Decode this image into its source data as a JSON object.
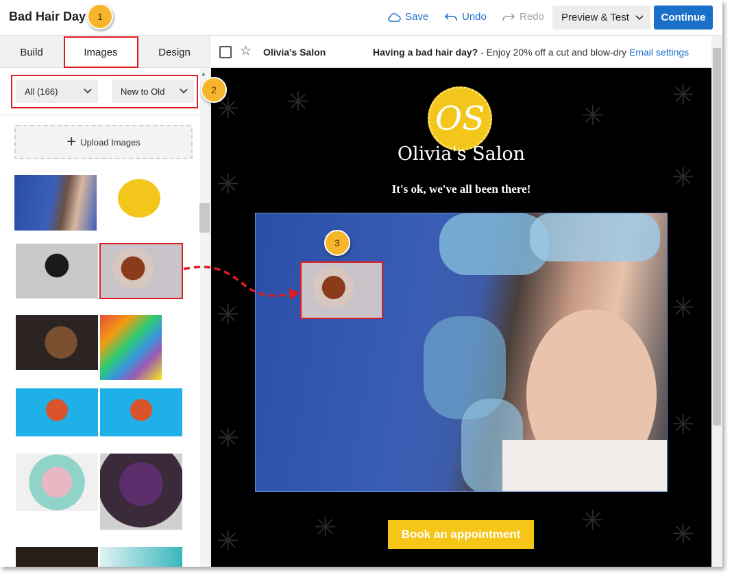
{
  "header": {
    "title": "Bad Hair Day",
    "save_label": "Save",
    "undo_label": "Undo",
    "redo_label": "Redo",
    "preview_label": "Preview & Test",
    "continue_label": "Continue"
  },
  "tabs": [
    {
      "label": "Build"
    },
    {
      "label": "Images"
    },
    {
      "label": "Design"
    }
  ],
  "filters": {
    "category": "All (166)",
    "sort": "New to Old"
  },
  "upload_label": "Upload Images",
  "email": {
    "from": "Olivia's Salon",
    "subject_bold": "Having a bad hair day?",
    "subject_rest": " - Enjoy 20% off a cut and blow-dry ",
    "settings_link": "Email settings"
  },
  "content": {
    "logo_monogram": "OS",
    "salon_name": "Olivia's Salon",
    "tagline": "It's ok, we've all been there!",
    "cta_label": "Book an appointment"
  },
  "annotations": {
    "step1": "1",
    "step2": "2",
    "step3": "3"
  },
  "colors": {
    "accent": "#1a6fc9",
    "highlight": "#e01b22",
    "callout": "#f7b52b",
    "cta": "#f5c518"
  },
  "icons": {
    "save": "cloud-icon",
    "undo": "undo-arrow-icon",
    "redo": "redo-arrow-icon",
    "dropdown": "chevron-down-icon",
    "upload": "plus-icon",
    "favorite": "star-icon"
  }
}
